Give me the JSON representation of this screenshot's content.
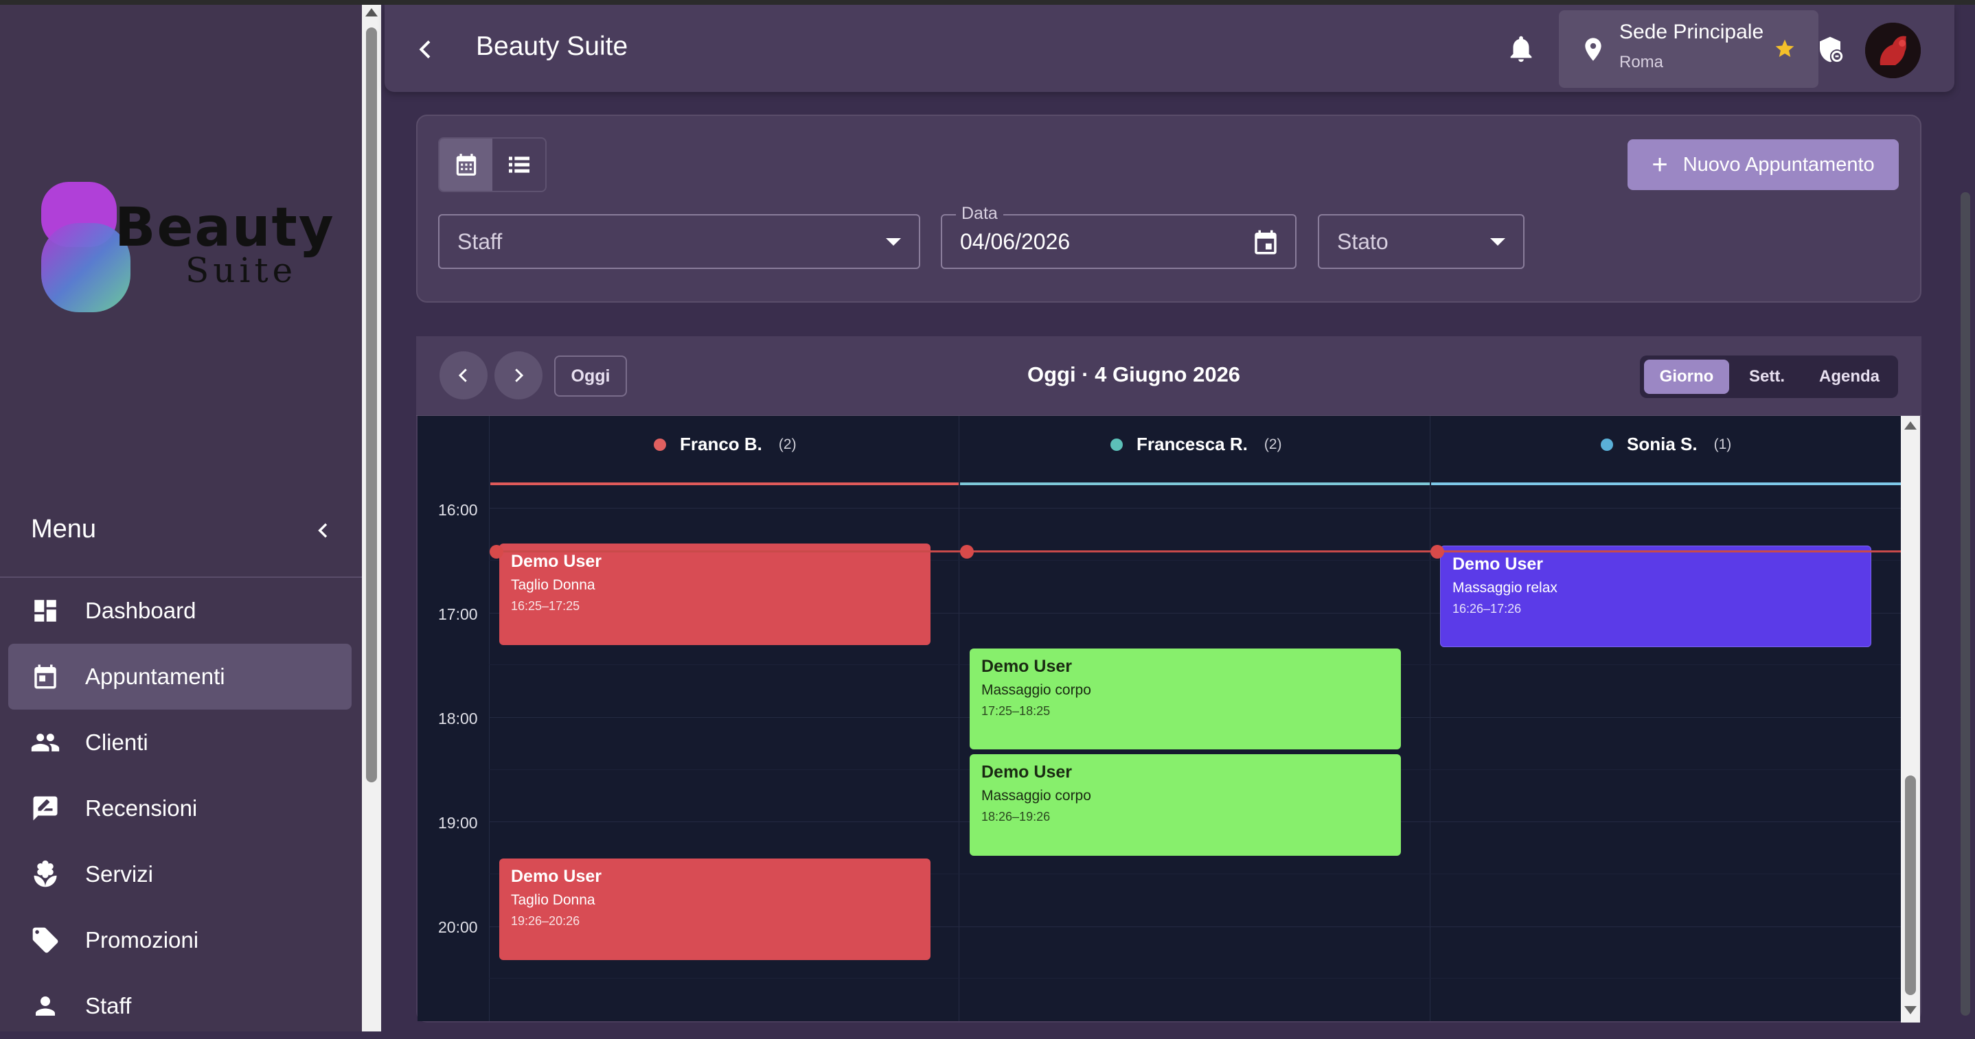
{
  "brand": {
    "logo_word1": "Beauty",
    "logo_word2": "Suite"
  },
  "sidebar": {
    "menu_title": "Menu",
    "items": [
      {
        "label": "Dashboard",
        "icon": "dashboard-icon",
        "active": false
      },
      {
        "label": "Appuntamenti",
        "icon": "calendar-icon",
        "active": true
      },
      {
        "label": "Clienti",
        "icon": "people-icon",
        "active": false
      },
      {
        "label": "Recensioni",
        "icon": "review-icon",
        "active": false
      },
      {
        "label": "Servizi",
        "icon": "spa-icon",
        "active": false
      },
      {
        "label": "Promozioni",
        "icon": "tag-icon",
        "active": false
      },
      {
        "label": "Staff",
        "icon": "person-icon",
        "active": false
      }
    ]
  },
  "appbar": {
    "title": "Beauty Suite",
    "location_name": "Sede Principale",
    "location_city": "Roma"
  },
  "filters": {
    "new_appointment_label": "Nuovo Appuntamento",
    "staff_placeholder": "Staff",
    "date_label": "Data",
    "date_value": "04/06/2026",
    "status_placeholder": "Stato"
  },
  "calendar": {
    "today_label": "Oggi",
    "title": "Oggi · 4 Giugno 2026",
    "views": {
      "day": "Giorno",
      "week": "Sett.",
      "agenda": "Agenda"
    },
    "active_view": "Giorno",
    "hours": [
      "16:00",
      "17:00",
      "18:00",
      "19:00",
      "20:00"
    ],
    "staff": [
      {
        "name": "Franco B.",
        "count": "(2)",
        "color": "#e06060"
      },
      {
        "name": "Francesca R.",
        "count": "(2)",
        "color": "#5cc0b8"
      },
      {
        "name": "Sonia S.",
        "count": "(1)",
        "color": "#5ab0d8"
      }
    ],
    "appointments": [
      {
        "client": "Demo User",
        "service": "Taglio Donna",
        "time": "16:25–17:25"
      },
      {
        "client": "Demo User",
        "service": "Taglio Donna",
        "time": "19:26–20:26"
      },
      {
        "client": "Demo User",
        "service": "Massaggio corpo",
        "time": "17:25–18:25"
      },
      {
        "client": "Demo User",
        "service": "Massaggio corpo",
        "time": "18:26–19:26"
      },
      {
        "client": "Demo User",
        "service": "Massaggio relax",
        "time": "16:26–17:26"
      }
    ]
  },
  "colors": {
    "accent": "#9b87c4",
    "appt_red": "#d84c54",
    "appt_green": "#87ef6c",
    "appt_purple": "#5b3be8",
    "now_line": "#c94a4a"
  }
}
